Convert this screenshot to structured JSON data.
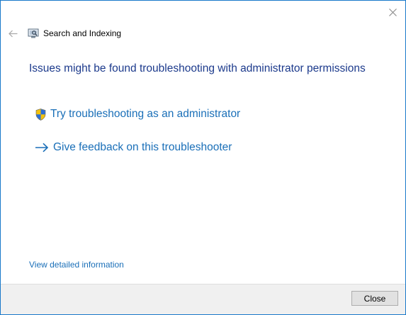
{
  "window": {
    "app_title": "Search and Indexing",
    "icons": {
      "close": "close-icon",
      "back": "back-arrow-icon",
      "app": "search-indexing-icon"
    }
  },
  "main": {
    "heading": "Issues might be found troubleshooting with administrator permissions",
    "options": [
      {
        "label": "Try troubleshooting as an administrator",
        "icon": "uac-shield-icon"
      },
      {
        "label": "Give feedback on this troubleshooter",
        "icon": "arrow-right-icon"
      }
    ],
    "details_link": "View detailed information"
  },
  "footer": {
    "close_label": "Close"
  },
  "colors": {
    "border": "#1979ca",
    "heading": "#1c3a8c",
    "link": "#1a6fb8",
    "footer_bg": "#f0f0f0"
  }
}
